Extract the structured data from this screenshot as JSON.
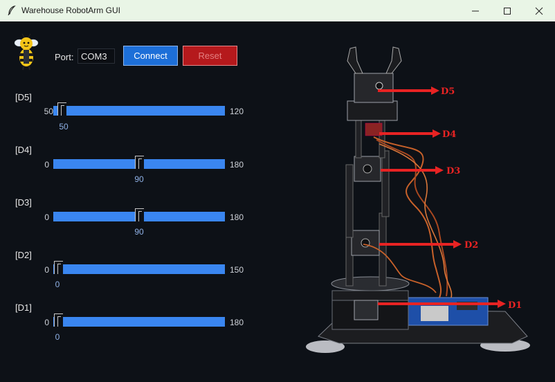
{
  "window": {
    "title": "Warehouse RobotArm GUI"
  },
  "toolbar": {
    "port_label": "Port:",
    "port_value": "COM3",
    "connect_label": "Connect",
    "reset_label": "Reset"
  },
  "joints": [
    {
      "label": "[D5]",
      "min": "50",
      "max": "120",
      "value": "50"
    },
    {
      "label": "[D4]",
      "min": "0",
      "max": "180",
      "value": "90"
    },
    {
      "label": "[D3]",
      "min": "0",
      "max": "180",
      "value": "90"
    },
    {
      "label": "[D2]",
      "min": "0",
      "max": "150",
      "value": "0"
    },
    {
      "label": "[D1]",
      "min": "0",
      "max": "180",
      "value": "0"
    }
  ],
  "diagram": {
    "tags": [
      "D5",
      "D4",
      "D3",
      "D2",
      "D1"
    ]
  },
  "colors": {
    "background": "#0d1117",
    "slider_track": "#3a86f0",
    "connect_button": "#1d6fd8",
    "reset_button": "#b5191c",
    "arrow": "#e82323"
  }
}
